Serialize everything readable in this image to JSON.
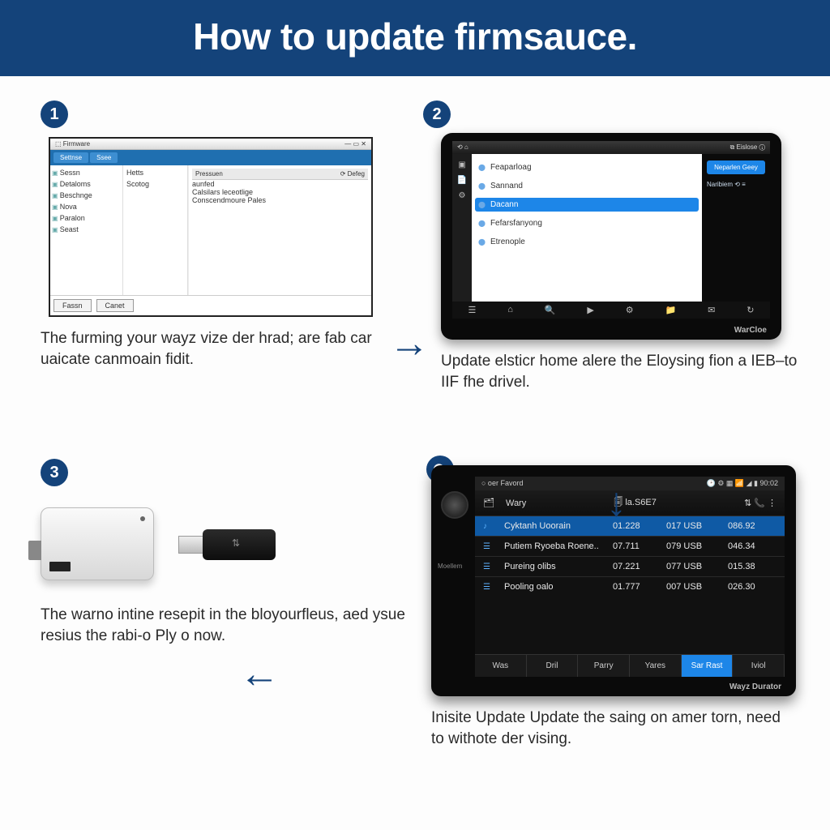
{
  "title": "How to update firmsauce.",
  "arrows": {
    "right": "→",
    "down": "→",
    "left": "→"
  },
  "step1": {
    "num": "1",
    "caption": "The furming your wayz vize der hrad; are fab car uaicate canmoain fidit.",
    "pc": {
      "title_left": "⬚ Firmware",
      "title_right": "— ▭ ✕",
      "tabs": [
        "Settnse",
        "Ssee"
      ],
      "nav": [
        "Sessn",
        "Detaloms",
        "Beschnge",
        "Nova",
        "Paralon",
        "Seast"
      ],
      "mid": [
        "Hetts",
        "Scotog"
      ],
      "detail_head_l": "Pressuen",
      "detail_head_r": "⟳ Defeg",
      "lines": [
        "aunfed",
        "Calsilars leceotlige",
        "Conscendmoure Pales"
      ],
      "btn1": "Fassn",
      "btn2": "Canet"
    }
  },
  "step2": {
    "num": "2",
    "caption": "Update elsticr home alere the Eloysing fion a IEB–to IIF fhe drivel.",
    "tab": {
      "top_left": "⟲ ⌂",
      "top_right": "⧉ Eislose  ⓘ",
      "side": [
        "▣",
        "📄",
        "⚙"
      ],
      "list": [
        "Feaparloag",
        "Sannand",
        "Dacann",
        "Fefarsfanyong",
        "Etrenople"
      ],
      "selected_index": 2,
      "right_btn": "Neparlen Geey",
      "right_text": "Naribiem\n⟲ ≡",
      "dock": [
        "☰",
        "⌂",
        "🔍",
        "▶",
        "⚙",
        "📁",
        "✉",
        "↻"
      ],
      "brand": "WarCloe"
    }
  },
  "step3": {
    "num": "3",
    "caption": "The warno intine resepit in the bloyourfleus, aed ysue resius the rabi-o Ply o now."
  },
  "step4": {
    "num": "⟳",
    "caption": "Inisite Update Update the saing on amer torn, need to withote der vising.",
    "hu": {
      "status_left": "○ oer Favord",
      "status_right": "🕑 ⚙ ▦ 📶 ◢ ▮ 90:02",
      "head_icon": "🗂",
      "head_title": "Wary",
      "head_center": "🗐 la.S6E7",
      "head_icons": "⇅   📞   ⋮",
      "rows": [
        {
          "ico": "♪",
          "name": "Cyktanh Uoorain",
          "c1": "01.228",
          "c2": "017 USB",
          "c3": "086.92"
        },
        {
          "ico": "☰",
          "name": "Putiem Ryoeba Roene..",
          "c1": "07.711",
          "c2": "079 USB",
          "c3": "046.34"
        },
        {
          "ico": "☰",
          "name": "Pureing olibs",
          "c1": "07.221",
          "c2": "077 USB",
          "c3": "015.38"
        },
        {
          "ico": "☰",
          "name": "Pooling oalo",
          "c1": "01.777",
          "c2": "007 USB",
          "c3": "026.30"
        }
      ],
      "selected_row": 0,
      "tabs": [
        "Was",
        "Dril",
        "Parry",
        "Yares",
        "Sar Rast",
        "Iviol"
      ],
      "tab_primary": 4,
      "brand": "Wayz Durator",
      "sidelabel": "Moellem"
    }
  }
}
